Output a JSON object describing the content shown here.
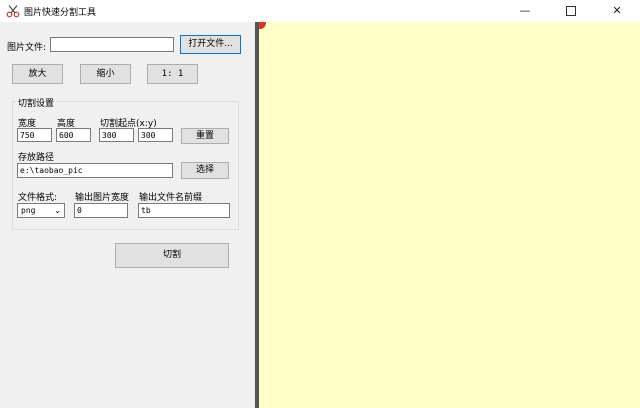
{
  "window": {
    "title": "图片快速分割工具",
    "minimize_glyph": "—",
    "close_glyph": "✕"
  },
  "file": {
    "label": "图片文件:",
    "value": "",
    "open_button": "打开文件..."
  },
  "zoom": {
    "zoom_in": "放大",
    "zoom_out": "缩小",
    "reset": "1: 1"
  },
  "cut_settings": {
    "group_title": "切割设置",
    "width_label": "宽度",
    "height_label": "高度",
    "origin_label": "切割起点(x:y)",
    "width_value": "750",
    "height_value": "600",
    "origin_x_value": "300",
    "origin_y_value": "300",
    "reset_button": "重置",
    "path_label": "存放路径",
    "path_value": "e:\\taobao_pic",
    "choose_button": "选择",
    "format_label": "文件格式:",
    "format_value": "png",
    "out_width_label": "输出图片宽度",
    "out_width_value": "0",
    "prefix_label": "输出文件名前缀",
    "prefix_value": "tb"
  },
  "cut_button": "切割",
  "colors": {
    "canvas_bg": "#ffffc8",
    "marker": "#e0312a",
    "divider": "#555555"
  }
}
